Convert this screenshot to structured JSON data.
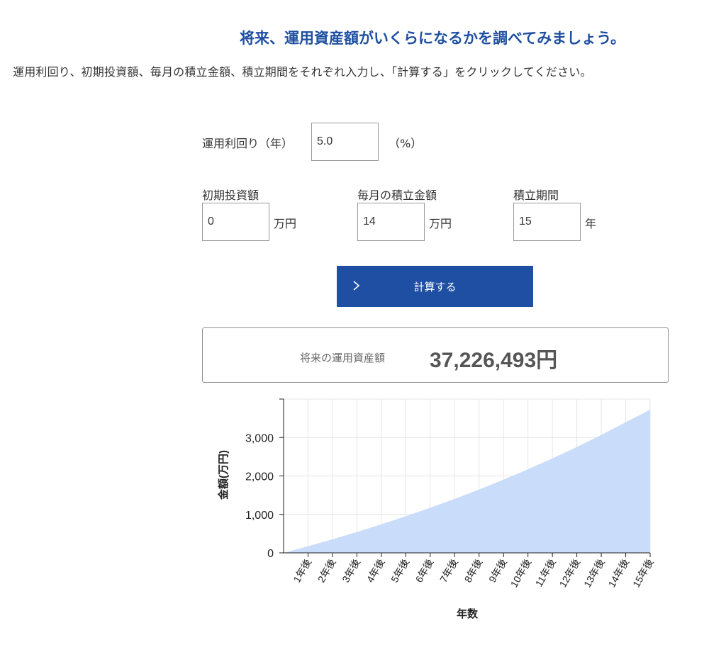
{
  "heading": "将来、運用資産額がいくらになるかを調べてみましょう。",
  "instructions": "運用利回り、初期投資額、毎月の積立金額、積立期間をそれぞれ入力し、「計算する」をクリックしてください。",
  "form": {
    "rate": {
      "label": "運用利回り（年）",
      "value": "5.0",
      "unit": "（%）"
    },
    "initial": {
      "label": "初期投資額",
      "value": "0",
      "unit": "万円"
    },
    "monthly": {
      "label": "毎月の積立金額",
      "value": "14",
      "unit": "万円"
    },
    "period": {
      "label": "積立期間",
      "value": "15",
      "unit": "年"
    }
  },
  "calculate_button": {
    "label": "計算する",
    "icon": "chevron-right-icon"
  },
  "result": {
    "label": "将来の運用資産額",
    "value": "37,226,493円"
  },
  "colors": {
    "heading": "#1f4fa0",
    "button": "#1f4fa3",
    "area_fill": "#c9dcfa"
  },
  "chart_data": {
    "type": "area",
    "x": [
      "1年後",
      "2年後",
      "3年後",
      "4年後",
      "5年後",
      "6年後",
      "7年後",
      "8年後",
      "9年後",
      "10年後",
      "11年後",
      "12年後",
      "13年後",
      "14年後",
      "15年後"
    ],
    "series": [
      {
        "values": [
          172,
          352,
          542,
          742,
          952,
          1172,
          1404,
          1648,
          1904,
          2173,
          2457,
          2754,
          3067,
          3396,
          3723
        ]
      }
    ],
    "xlabel": "年数",
    "ylabel": "金額(万円)",
    "yticks": [
      0,
      1000,
      2000,
      3000
    ],
    "ytick_labels": [
      "0",
      "1,000",
      "2,000",
      "3,000"
    ],
    "ylim": [
      0,
      4000
    ],
    "grid": true,
    "legend": "none"
  }
}
